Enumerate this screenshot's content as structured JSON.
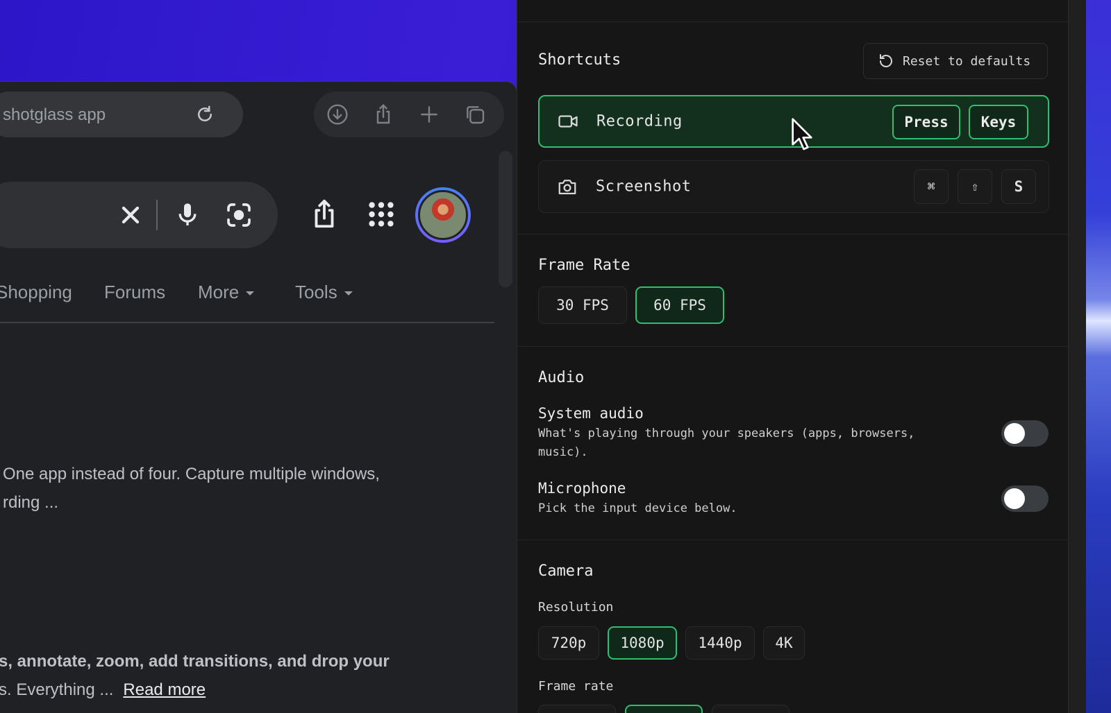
{
  "browser": {
    "url_text": "shotglass app",
    "tabs": [
      {
        "label": "Shopping",
        "has_caret": false
      },
      {
        "label": "Forums",
        "has_caret": false
      },
      {
        "label": "More",
        "has_caret": true
      },
      {
        "label": "Tools",
        "has_caret": true
      }
    ],
    "result1": {
      "line1": "One app instead of four. Capture multiple windows,",
      "line2": "rding ..."
    },
    "result2": {
      "line1": "s, annotate, zoom, add transitions, and drop your",
      "line2": "s. Everything ...",
      "link": "Read more"
    }
  },
  "panel": {
    "shortcuts": {
      "title": "Shortcuts",
      "reset_label": "Reset to defaults",
      "recording": {
        "label": "Recording",
        "key1": "Press",
        "key2": "Keys"
      },
      "screenshot": {
        "label": "Screenshot",
        "keys": [
          "⌘",
          "⇧",
          "S"
        ]
      }
    },
    "frame_rate": {
      "title": "Frame Rate",
      "options": [
        "30 FPS",
        "60 FPS"
      ],
      "selected": "60 FPS"
    },
    "audio": {
      "title": "Audio",
      "system": {
        "title": "System audio",
        "desc": "What's playing through your speakers (apps, browsers, music).",
        "enabled": false
      },
      "mic": {
        "title": "Microphone",
        "desc": "Pick the input device below.",
        "enabled": false
      }
    },
    "camera": {
      "title": "Camera",
      "resolution_label": "Resolution",
      "resolutions": [
        "720p",
        "1080p",
        "1440p",
        "4K"
      ],
      "selected_resolution": "1080p",
      "frame_rate_label": "Frame rate"
    }
  },
  "colors": {
    "accent": "#2fbf71",
    "panel_bg": "#161616",
    "browser_bg": "#1f2124"
  }
}
